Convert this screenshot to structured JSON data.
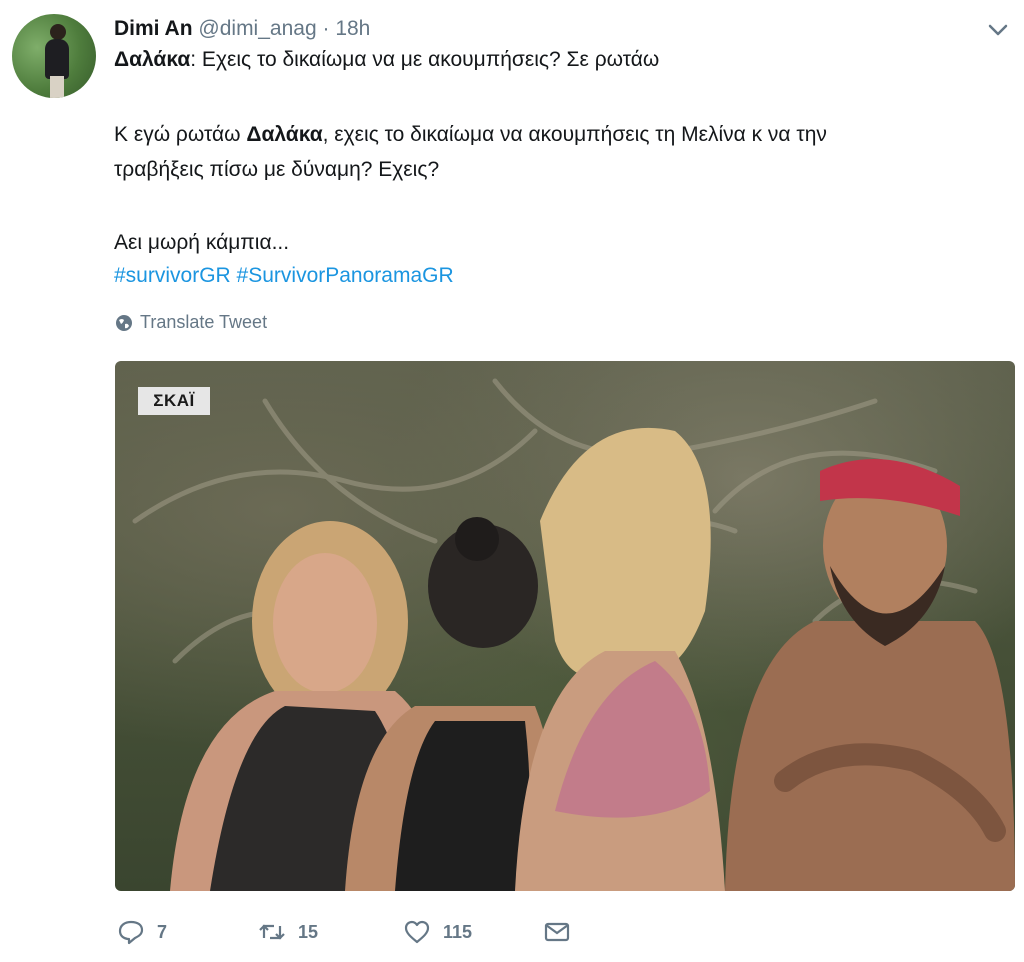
{
  "tweet": {
    "author_name": "Dimi An",
    "handle": "@dimi_anag",
    "separator": "·",
    "time": "18h",
    "lines": [
      {
        "bold": "Δαλάκα",
        "text": ": Εχεις το δικαίωμα να με ακουμπήσεις? Σε ρωτάω"
      },
      {
        "prefix": "Κ εγώ ρωτάω ",
        "bold": "Δαλάκα",
        "text": ", εχεις το δικαίωμα να ακουμπήσεις τη Μελίνα κ να την"
      },
      {
        "text": "τραβήξεις πίσω με δύναμη? Εχεις?"
      },
      {
        "text": "Αει μωρή κάμπια..."
      }
    ],
    "hashtags": [
      "#survivorGR",
      "#SurvivorPanoramaGR"
    ],
    "translate_label": "Translate Tweet",
    "media": {
      "channel_logo": "ΣΚΑΪ"
    },
    "actions": {
      "reply_count": "7",
      "retweet_count": "15",
      "like_count": "115"
    }
  },
  "icons": {
    "chevron": "chevron-down-icon",
    "globe": "globe-icon",
    "reply": "reply-icon",
    "retweet": "retweet-icon",
    "like": "heart-icon",
    "dm": "envelope-icon"
  },
  "colors": {
    "text": "#14171a",
    "muted": "#657786",
    "link": "#1b95e0"
  }
}
